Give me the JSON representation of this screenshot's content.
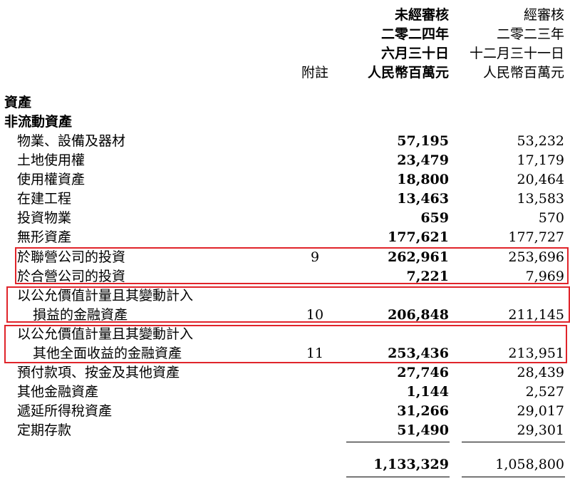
{
  "header": {
    "current": {
      "line1": "未經審核",
      "line2": "二零二四年",
      "line3": "六月三十日",
      "line4": "人民幣百萬元"
    },
    "prior": {
      "line1": "經審核",
      "line2": "二零二三年",
      "line3": "十二月三十一日",
      "line4": "人民幣百萬元"
    },
    "note": "附註"
  },
  "section": {
    "assets": "資產",
    "non_current": "非流動資產"
  },
  "rows": [
    {
      "label": "物業、設備及器材",
      "note": "",
      "current": "57,195",
      "prior": "53,232"
    },
    {
      "label": "土地使用權",
      "note": "",
      "current": "23,479",
      "prior": "17,179"
    },
    {
      "label": "使用權資產",
      "note": "",
      "current": "18,800",
      "prior": "20,464"
    },
    {
      "label": "在建工程",
      "note": "",
      "current": "13,463",
      "prior": "13,583"
    },
    {
      "label": "投資物業",
      "note": "",
      "current": "659",
      "prior": "570"
    },
    {
      "label": "無形資產",
      "note": "",
      "current": "177,621",
      "prior": "177,727"
    },
    {
      "label": "於聯營公司的投資",
      "note": "9",
      "current": "262,961",
      "prior": "253,696"
    },
    {
      "label": "於合營公司的投資",
      "note": "",
      "current": "7,221",
      "prior": "7,969"
    },
    {
      "label_a": "以公允價值計量且其變動計入",
      "label_b": "損益的金融資產",
      "note": "10",
      "current": "206,848",
      "prior": "211,145"
    },
    {
      "label_a": "以公允價值計量且其變動計入",
      "label_b": "其他全面收益的金融資產",
      "note": "11",
      "current": "253,436",
      "prior": "213,951"
    },
    {
      "label": "預付款項、按金及其他資產",
      "note": "",
      "current": "27,746",
      "prior": "28,439"
    },
    {
      "label": "其他金融資產",
      "note": "",
      "current": "1,144",
      "prior": "2,527"
    },
    {
      "label": "遞延所得稅資產",
      "note": "",
      "current": "31,266",
      "prior": "29,017"
    },
    {
      "label": "定期存款",
      "note": "",
      "current": "51,490",
      "prior": "29,301"
    }
  ],
  "total": {
    "current": "1,133,329",
    "prior": "1,058,800"
  },
  "colors": {
    "highlight": "#e0242a"
  }
}
